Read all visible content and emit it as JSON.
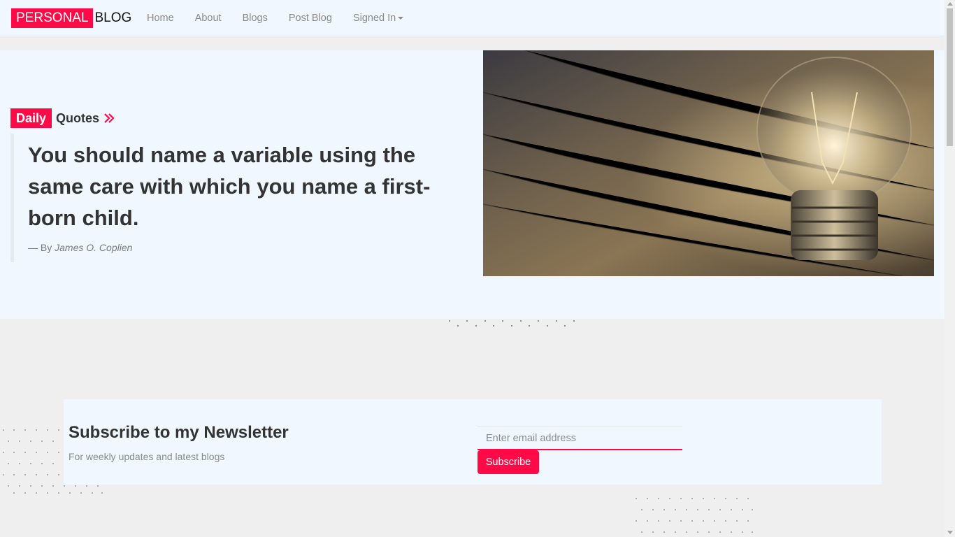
{
  "navbar": {
    "brand_red": "PERSONAL",
    "brand_dark": "BLOG",
    "links": [
      "Home",
      "About",
      "Blogs",
      "Post Blog"
    ],
    "user_menu": "Signed In"
  },
  "hero": {
    "badge": "Daily",
    "label": "Quotes",
    "quote": "You should name a variable using the same care with which you name a first-born child.",
    "author_prefix": "— By",
    "author": "James O. Coplien"
  },
  "newsletter": {
    "title": "Subscribe to my Newsletter",
    "subtitle": "For weekly updates and latest blogs",
    "email_placeholder": "Enter email address",
    "button": "Subscribe"
  },
  "colors": {
    "accent": "#ff0a47",
    "panel": "#f0f7ff",
    "page": "#efefef"
  }
}
